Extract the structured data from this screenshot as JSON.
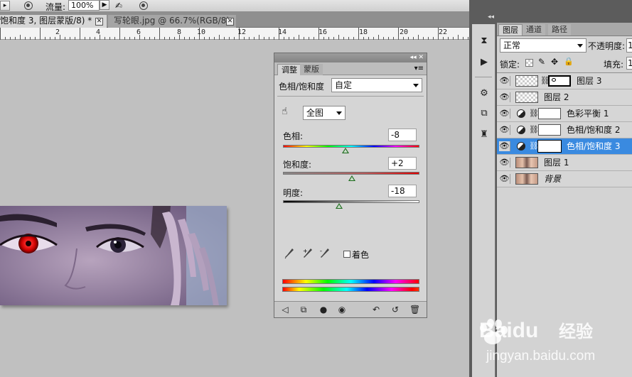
{
  "options_bar": {
    "flow_label": "流量:",
    "flow_value": "100%",
    "flow_arrow": "▶"
  },
  "doc_tabs": [
    {
      "label": "饱和度 3, 图层蒙版/8) *",
      "close": "✕"
    },
    {
      "label": "写轮眼.jpg @ 66.7%(RGB/8)",
      "close": "✕"
    }
  ],
  "ruler": {
    "numbers": [
      "2",
      "4",
      "6",
      "8",
      "10",
      "12",
      "14",
      "16",
      "18",
      "20",
      "22"
    ]
  },
  "adjust_panel": {
    "title_controls": "◂◂  ✕",
    "tabs": [
      "调整",
      "蒙版"
    ],
    "menu_icon": "▾≡",
    "preset_type_label": "色相/饱和度",
    "preset_value": "自定",
    "channel_value": "全图",
    "hue": {
      "label": "色相:",
      "value": "-8",
      "fraction": 0.46
    },
    "saturation": {
      "label": "饱和度:",
      "value": "+2",
      "fraction": 0.505
    },
    "lightness": {
      "label": "明度:",
      "value": "-18",
      "fraction": 0.41
    },
    "colorize_label": "着色",
    "colorize_checked": false
  },
  "layers_panel": {
    "tabs": [
      "图层",
      "通道",
      "路径"
    ],
    "blend_mode": "正常",
    "opacity_label": "不透明度:",
    "opacity_value": "1",
    "lock_label": "锁定:",
    "fill_label": "填充:",
    "fill_value": "1",
    "layers": [
      {
        "name": "图层 3",
        "kind": "masked-pixel",
        "selected": false
      },
      {
        "name": "图层 2",
        "kind": "pixel",
        "selected": false
      },
      {
        "name": "色彩平衡 1",
        "kind": "adjustment",
        "selected": false
      },
      {
        "name": "色相/饱和度 2",
        "kind": "adjustment",
        "selected": false
      },
      {
        "name": "色相/饱和度 3",
        "kind": "adjustment",
        "selected": true
      },
      {
        "name": "图层 1",
        "kind": "photo",
        "selected": false
      },
      {
        "name": "背景",
        "kind": "photo",
        "selected": false
      }
    ]
  },
  "watermark": {
    "brand": "Baidu",
    "brand_cn": "经验",
    "url": "jingyan.baidu.com"
  },
  "colors": {
    "selected_row": "#3a8ae0",
    "panel_bg": "#d5d5d5",
    "canvas_bg": "#c0c0c0",
    "dark_strip": "#5c5c5c"
  }
}
